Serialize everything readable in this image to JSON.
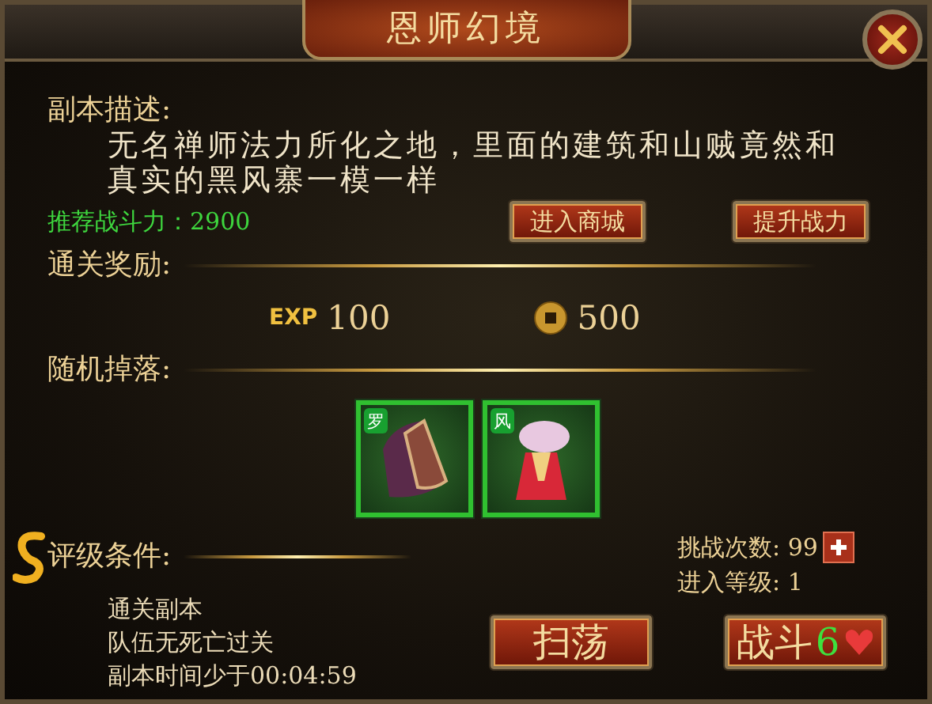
{
  "title": "恩师幻境",
  "description": {
    "label": "副本描述:",
    "text": "无名禅师法力所化之地，里面的建筑和山贼竟然和真实的黑风寨一模一样"
  },
  "recommended": "推荐战斗力：2900",
  "top_buttons": [
    "进入商城",
    "提升战力"
  ],
  "rewards": {
    "label": "通关奖励:",
    "items": [
      {
        "kind": "exp",
        "badge": "EXP",
        "amount": "100"
      },
      {
        "kind": "coin",
        "amount": "500"
      }
    ]
  },
  "drops": {
    "label": "随机掉落:",
    "items": [
      {
        "kind": "hat",
        "tag": "罗"
      },
      {
        "kind": "robe",
        "tag": "风"
      }
    ]
  },
  "rating": {
    "label": "评级条件:",
    "conditions": [
      "通关副本",
      "队伍无死亡过关",
      "副本时间少于00:04:59"
    ]
  },
  "stats": [
    {
      "kind": "addable",
      "label": "挑战次数:",
      "value": "99"
    },
    {
      "kind": "plain",
      "label": "进入等级:",
      "value": "1"
    }
  ],
  "actions": [
    {
      "kind": "sweep",
      "label": "扫荡"
    },
    {
      "kind": "battle",
      "label": "战斗",
      "count": "6"
    }
  ]
}
